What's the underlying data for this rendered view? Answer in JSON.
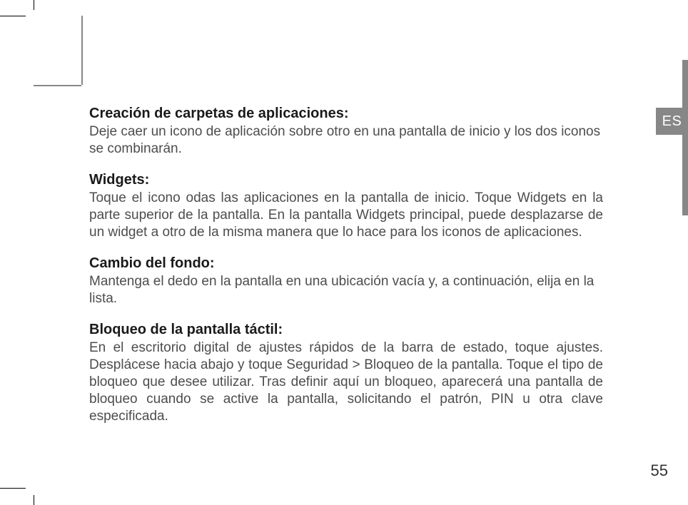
{
  "language_tab": "ES",
  "page_number": "55",
  "sections": [
    {
      "heading": "Creación de carpetas de aplicaciones:",
      "body": "Deje caer un icono de aplicación sobre otro en una pantalla de inicio y los dos iconos se combinarán.",
      "justify": false
    },
    {
      "heading": "Widgets:",
      "body": "Toque el icono odas las aplicaciones en la pantalla de inicio. Toque Widgets en la parte superior de la pantalla. En la pantalla Widgets principal, puede desplazarse de un widget a otro de la misma manera que lo hace para los iconos de aplicaciones.",
      "justify": true
    },
    {
      "heading": "Cambio del fondo:",
      "body": "Mantenga el dedo en la pantalla en una ubicación vacía y, a continuación, elija en la lista.",
      "justify": false
    },
    {
      "heading": "Bloqueo de la pantalla táctil:",
      "body": "En el escritorio digital de ajustes rápidos de la barra de estado, toque ajustes. Desplácese hacia abajo y toque Seguridad > Bloqueo de la pantalla. Toque el tipo de bloqueo que desee utilizar. Tras definir aquí un bloqueo, aparecerá una pantalla de bloqueo cuando se active la pantalla, solicitando el patrón, PIN u otra clave especificada.",
      "justify": true
    }
  ]
}
